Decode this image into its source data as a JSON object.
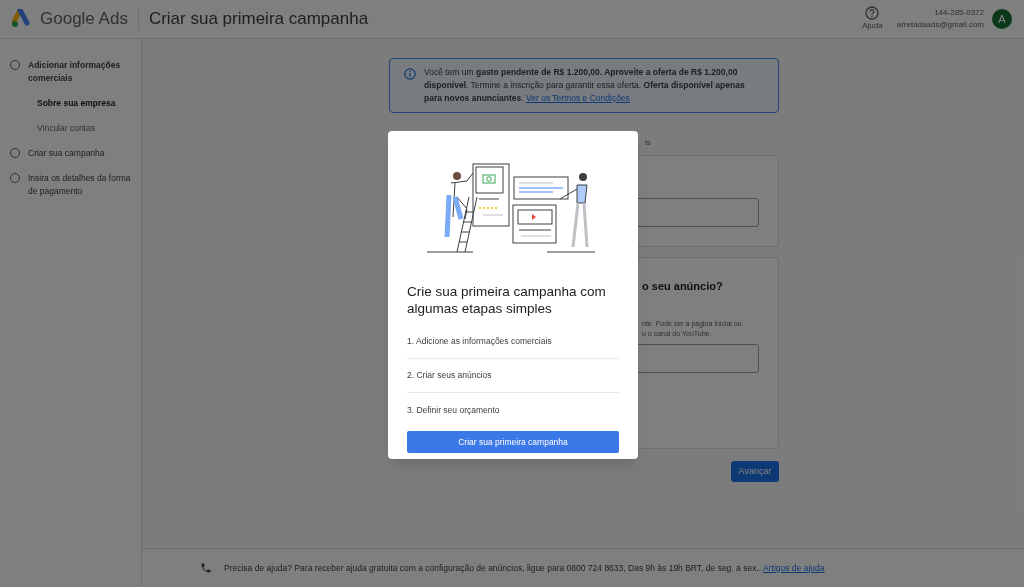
{
  "header": {
    "product": "Google Ads",
    "title": "Criar sua primeira campanha",
    "help_label": "Ajuda",
    "account_id": "144-285-0372",
    "email": "arretadaads@gmail.com",
    "avatar_letter": "A"
  },
  "sidebar": {
    "steps": [
      {
        "label": "Adicionar informações comerciais",
        "selected": false,
        "children": [
          {
            "label": "Sobre sua empresa",
            "selected": true
          },
          {
            "label": "Vincular contas",
            "selected": false
          }
        ]
      },
      {
        "label": "Criar sua campanha",
        "selected": false
      },
      {
        "label": "Insira os detalhes da forma de pagamento",
        "selected": false
      }
    ]
  },
  "banner": {
    "text": "Você tem um **gasto pendente de R$ 1.200,00. Aproveite a oferta de R$ 1.200,00 disponível**. Termine a inscrição para garantir essa oferta. **Oferta disponível apenas para novos anunciantes**.",
    "link": "Ver os Termos e Condições"
  },
  "background_fragments": {
    "subtitle_end": "is",
    "card_heading_end": "o seu anúncio?",
    "card_hint_line_1_end": "nte. Pode ser a página inicial ou",
    "card_hint_line_2_end": "u o canal do YouTube."
  },
  "next_button": "Avançar",
  "footer": {
    "text": "Precisa de ajuda? Para receber ajuda gratuita com a configuração de anúncios, ligue para 0800 724 8633, Das 9h às 19h BRT, de seg. a sex..",
    "link": "Artigos de ajuda"
  },
  "dialog": {
    "title": "Crie sua primeira campanha com algumas etapas simples",
    "steps": [
      "1. Adicione as informações comerciais",
      "2. Criar seus anúncios",
      "3. Definir seu orçamento"
    ],
    "button": "Criar sua primeira campanha"
  }
}
